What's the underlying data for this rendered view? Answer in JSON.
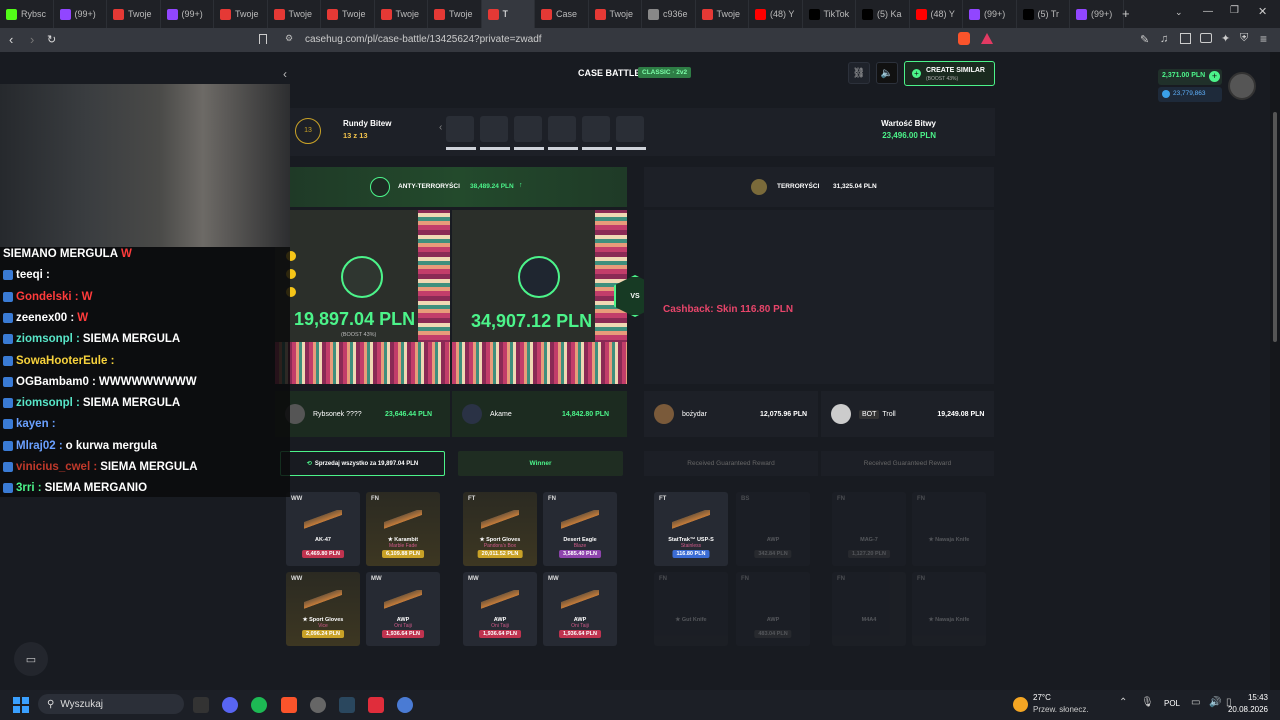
{
  "browser": {
    "tabs": [
      {
        "label": "Rybsc",
        "color": "#53fc18"
      },
      {
        "label": "(99+)",
        "color": "#9146ff"
      },
      {
        "label": "Twoje",
        "color": "#e53935"
      },
      {
        "label": "(99+)",
        "color": "#9146ff"
      },
      {
        "label": "Twoje",
        "color": "#e53935"
      },
      {
        "label": "Twoje",
        "color": "#e53935"
      },
      {
        "label": "Twoje",
        "color": "#e53935"
      },
      {
        "label": "Twoje",
        "color": "#e53935"
      },
      {
        "label": "Twoje",
        "color": "#e53935"
      },
      {
        "label": "T",
        "color": "#e53935",
        "active": true
      },
      {
        "label": "Case",
        "color": "#e53935"
      },
      {
        "label": "Twoje",
        "color": "#e53935"
      },
      {
        "label": "c936e",
        "color": "#888888"
      },
      {
        "label": "Twoje",
        "color": "#e53935"
      },
      {
        "label": "(48) Y",
        "color": "#ff0000"
      },
      {
        "label": "TikTok",
        "color": "#000000"
      },
      {
        "label": "(5) Ka",
        "color": "#000000"
      },
      {
        "label": "(48) Y",
        "color": "#ff0000"
      },
      {
        "label": "(99+)",
        "color": "#9146ff"
      },
      {
        "label": "(5) Tr",
        "color": "#000000"
      },
      {
        "label": "(99+)",
        "color": "#9146ff"
      }
    ],
    "url": "casehug.com/pl/case-battle/13425624?private=zwadf"
  },
  "chat": [
    {
      "user": "SIEMANO MERGULA",
      "ucolor": "#ffffff",
      "msg": "W",
      "mcolor": "#ff3b3b"
    },
    {
      "user": "teeqi",
      "ucolor": "#ffffff",
      "msg": "",
      "mcolor": "#fff"
    },
    {
      "user": "Gondelski",
      "ucolor": "#ff3b3b",
      "msg": "W",
      "mcolor": "#ff3b3b"
    },
    {
      "user": "zeenex00",
      "ucolor": "#ffffff",
      "msg": "W",
      "mcolor": "#ff3b3b"
    },
    {
      "user": "ziomsonpl",
      "ucolor": "#58e6c8",
      "msg": "SIEMA MERGULA",
      "mcolor": "#fff"
    },
    {
      "user": "SowaHooterEule",
      "ucolor": "#f7d23c",
      "msg": "",
      "mcolor": "#fff"
    },
    {
      "user": "OGBambam0",
      "ucolor": "#ffffff",
      "msg": "WWWWWWWWW",
      "mcolor": "#fff"
    },
    {
      "user": "ziomsonpl",
      "ucolor": "#58e6c8",
      "msg": "SIEMA MERGULA",
      "mcolor": "#fff"
    },
    {
      "user": "kayen",
      "ucolor": "#6aa0ff",
      "msg": "",
      "mcolor": "#fff"
    },
    {
      "user": "Mlraj02",
      "ucolor": "#6aa0ff",
      "msg": "o kurwa mergula",
      "mcolor": "#fff"
    },
    {
      "user": "vinicius_cwel",
      "ucolor": "#c0392b",
      "msg": "SIEMA MERGULA",
      "mcolor": "#fff"
    },
    {
      "user": "3rri",
      "ucolor": "#4cf48a",
      "msg": "SIEMA MERGANIO",
      "mcolor": "#fff"
    }
  ],
  "battle": {
    "title": "CASE BATTLE",
    "mode": "CLASSIC · 2v2",
    "create_similar": "CREATE SIMILAR",
    "create_similar_sub": "(BOOST 43%)",
    "balance": "2,371.00 PLN",
    "coins": "23,779,863",
    "round_number": "13",
    "rounds_label": "Rundy Bitew",
    "rounds_value": "13 z 13",
    "value_label": "Wartość Bitwy",
    "value_amount": "23,496.00 PLN",
    "team_a": "ANTY-TERRORYŚCI",
    "team_a_value": "38,489.24 PLN",
    "team_b": "TERRORYŚCI",
    "team_b_value": "31,325.04 PLN",
    "slot1_amount": "19,897.04 PLN",
    "slot1_boost": "(BOOST 43%)",
    "slot2_amount": "34,907.12 PLN",
    "vs": "VS",
    "cashback": "Cashback: Skin 116.80 PLN",
    "players": [
      {
        "name": "Rybsonek ????",
        "value": "23,646.44 PLN"
      },
      {
        "name": "Akame",
        "value": "14,842.80 PLN"
      },
      {
        "name": "bożydar",
        "value": "12,075.96 PLN"
      },
      {
        "bot": "BOT",
        "name": "Troll",
        "value": "19,249.08 PLN"
      }
    ],
    "sell_all": "Sprzedaj wszystko za 19,897.04 PLN",
    "winner": "Winner",
    "guaranteed": "Received Guaranteed Reward"
  },
  "items": [
    {
      "cond": "WW",
      "name": "AK-47",
      "sub": "",
      "price": "6,469.80 PLN",
      "pc": "#c0334f"
    },
    {
      "cond": "FN",
      "name": "★ Karambit",
      "sub": "Marble Fade",
      "price": "6,109.88 PLN",
      "pc": "#c9a227"
    },
    {
      "cond": "FT",
      "name": "★ Sport Gloves",
      "sub": "Pandora's Box",
      "price": "20,011.52 PLN",
      "pc": "#c9a227"
    },
    {
      "cond": "FN",
      "name": "Desert Eagle",
      "sub": "Blaze",
      "price": "3,585.40 PLN",
      "pc": "#8e44ad"
    },
    {
      "cond": "FT",
      "name": "StatTrak™ USP-S",
      "sub": "Stainless",
      "price": "116.80 PLN",
      "pc": "#3b6cd4"
    },
    {
      "cond": "WW",
      "name": "★ Sport Gloves",
      "sub": "Vice",
      "price": "2,096.24 PLN",
      "pc": "#c9a227"
    },
    {
      "cond": "MW",
      "name": "AWP",
      "sub": "Oni Taiji",
      "price": "1,936.64 PLN",
      "pc": "#c0334f"
    },
    {
      "cond": "MW",
      "name": "AWP",
      "sub": "Oni Taiji",
      "price": "1,936.64 PLN",
      "pc": "#c0334f"
    },
    {
      "cond": "MW",
      "name": "AWP",
      "sub": "Oni Taiji",
      "price": "1,936.64 PLN",
      "pc": "#c0334f"
    }
  ],
  "faded_items": [
    {
      "cond": "BS",
      "name": "AWP",
      "price": "342.84 PLN"
    },
    {
      "cond": "FN",
      "name": "MAG-7",
      "price": "1,127.20 PLN"
    },
    {
      "cond": "FN",
      "name": "★ Nawaja Knife",
      "price": ""
    },
    {
      "cond": "FN",
      "name": "★ Gut Knife",
      "price": ""
    },
    {
      "cond": "FN",
      "name": "AWP",
      "price": "483.04 PLN"
    },
    {
      "cond": "FN",
      "name": "M4A4",
      "price": ""
    },
    {
      "cond": "FN",
      "name": "★ Nawaja Knife",
      "price": ""
    }
  ],
  "taskbar": {
    "search": "Wyszukaj",
    "weather_temp": "27°C",
    "weather_desc": "Przew. słonecz.",
    "lang": "POL",
    "time": "15:43",
    "date": "20.08.2026"
  }
}
